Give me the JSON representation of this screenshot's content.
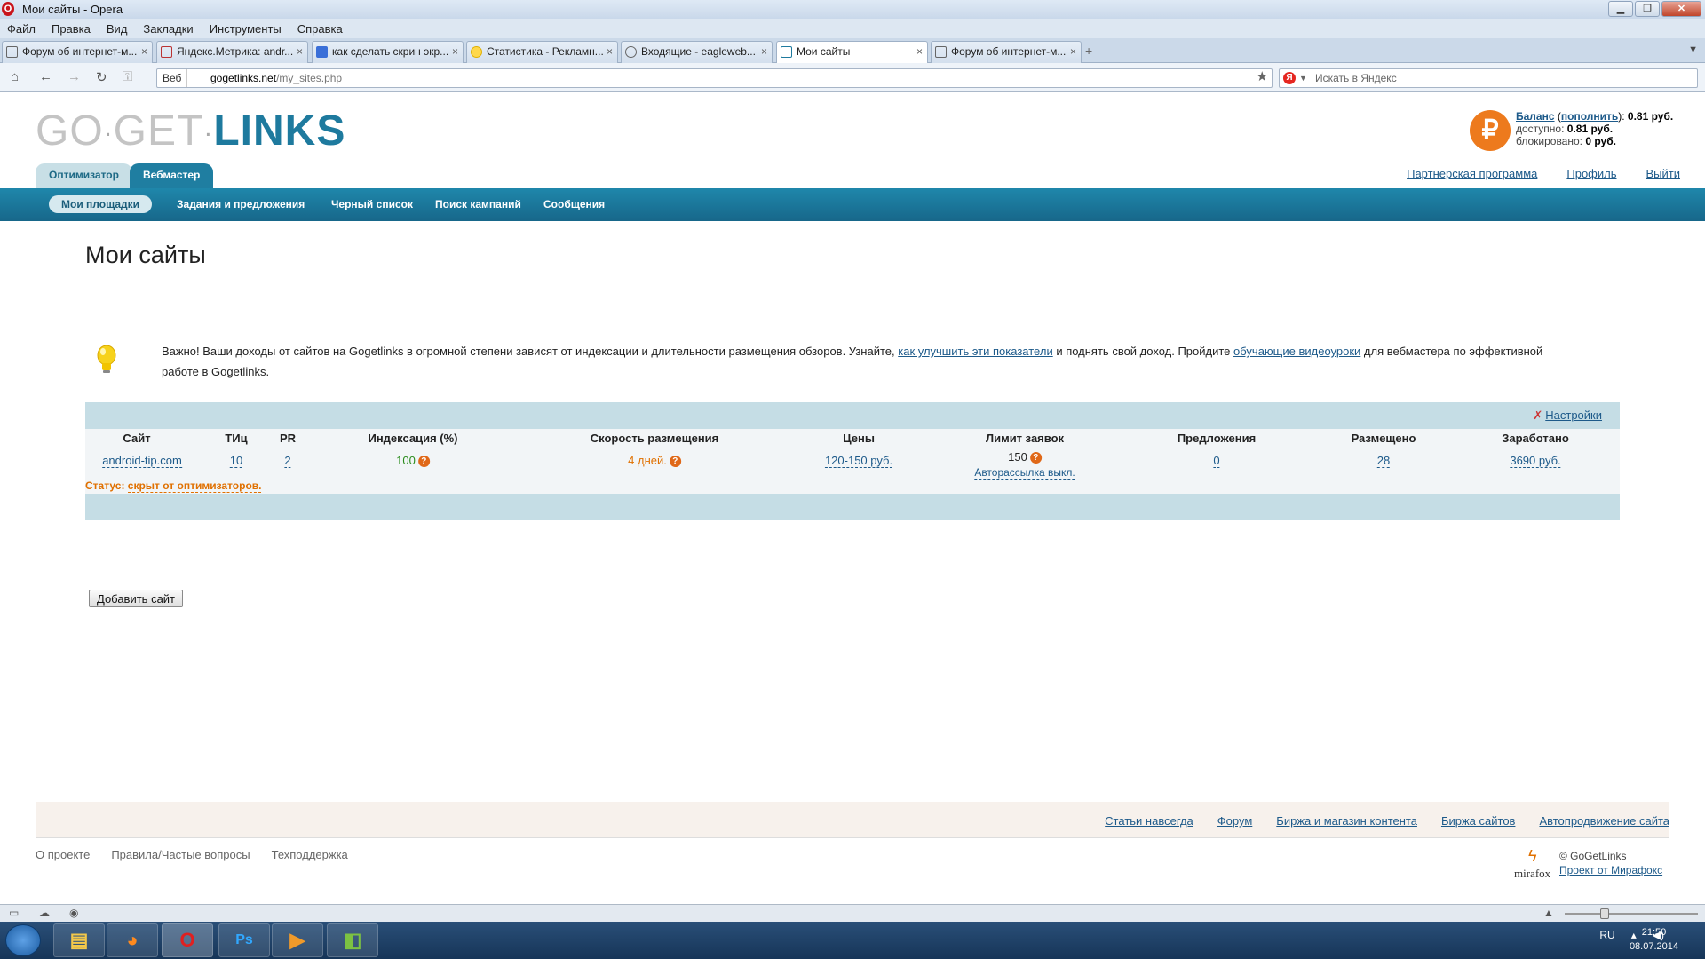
{
  "window": {
    "title": "Мои сайты - Opera",
    "minimize": "▁",
    "maximize": "❐",
    "close": "✕"
  },
  "menu": [
    "Файл",
    "Правка",
    "Вид",
    "Закладки",
    "Инструменты",
    "Справка"
  ],
  "tabs": [
    {
      "label": "Форум об интернет-м...",
      "active": false
    },
    {
      "label": "Яндекс.Метрика: andr...",
      "active": false
    },
    {
      "label": "как сделать скрин экр...",
      "active": false
    },
    {
      "label": "Статистика - Рекламн...",
      "active": false
    },
    {
      "label": "Входящие - eagleweb...",
      "active": false
    },
    {
      "label": "Мои сайты",
      "active": true
    },
    {
      "label": "Форум об интернет-м...",
      "active": false
    }
  ],
  "tab_close": "×",
  "new_tab": "+",
  "tab_menu": "▼",
  "nav": {
    "web_label": "Веб",
    "url_domain": "gogetlinks.net",
    "url_path": "/my_sites.php",
    "search_placeholder": "Искать в Яндекс",
    "yandex_letter": "Я"
  },
  "site": {
    "logo": {
      "go": "GO",
      "get": "GET",
      "links": "LINKS",
      "dot": "·"
    },
    "ruble_symbol": "₽",
    "balance": {
      "balance_label": "Баланс",
      "topup_label": "пополнить",
      "balance_value": "0.81 руб.",
      "available_label": "доступно:",
      "available_value": "0.81 руб.",
      "blocked_label": "блокировано:",
      "blocked_value": "0 руб."
    },
    "role_tabs": {
      "optimizer": "Оптимизатор",
      "webmaster": "Вебмастер"
    },
    "top_links": [
      "Партнерская программа",
      "Профиль",
      "Выйти"
    ],
    "subnav": [
      "Мои площадки",
      "Задания и предложения",
      "Черный список",
      "Поиск кампаний",
      "Сообщения"
    ],
    "page_title": "Мои сайты",
    "notice": {
      "part1": "Важно! Ваши доходы от сайтов на Gogetlinks в огромной степени зависят от индексации и длительности размещения обзоров. Узнайте, ",
      "link1": "как улучшить эти показатели",
      "part2": " и поднять свой доход. Пройдите ",
      "link2": "обучающие видеоуроки",
      "part3": " для вебмастера по эффективной работе в Gogetlinks."
    },
    "table": {
      "settings_label": "Настройки",
      "headers": [
        "Сайт",
        "ТИц",
        "PR",
        "Индексация (%)",
        "Скорость размещения",
        "Цены",
        "Лимит заявок",
        "Предложения",
        "Размещено",
        "Заработано"
      ],
      "row": {
        "site": "android-tip.com",
        "tic": "10",
        "pr": "2",
        "indexation": "100",
        "speed": "4 дней.",
        "prices": "120-150 руб.",
        "limit": "150",
        "autosend": "Авторассылка выкл.",
        "offers": "0",
        "placed": "28",
        "earned": "3690 руб."
      },
      "help_symbol": "?",
      "status_label": "Статус:",
      "status_value": "скрыт от оптимизаторов.",
      "add_button": "Добавить сайт"
    },
    "footer": {
      "links": [
        "Статьи навсегда",
        "Форум",
        "Биржа и магазин контента",
        "Биржа сайтов",
        "Автопродвижение сайта"
      ],
      "bottom_links": [
        "О проекте",
        "Правила/Частые вопросы",
        "Техподдержка"
      ],
      "mirafox_word": "mirafox",
      "copyright": "© GoGetLinks",
      "project_link": "Проект от Мирафокс"
    }
  },
  "taskbar": {
    "lang": "RU",
    "time": "21:50",
    "date": "08.07.2014"
  }
}
